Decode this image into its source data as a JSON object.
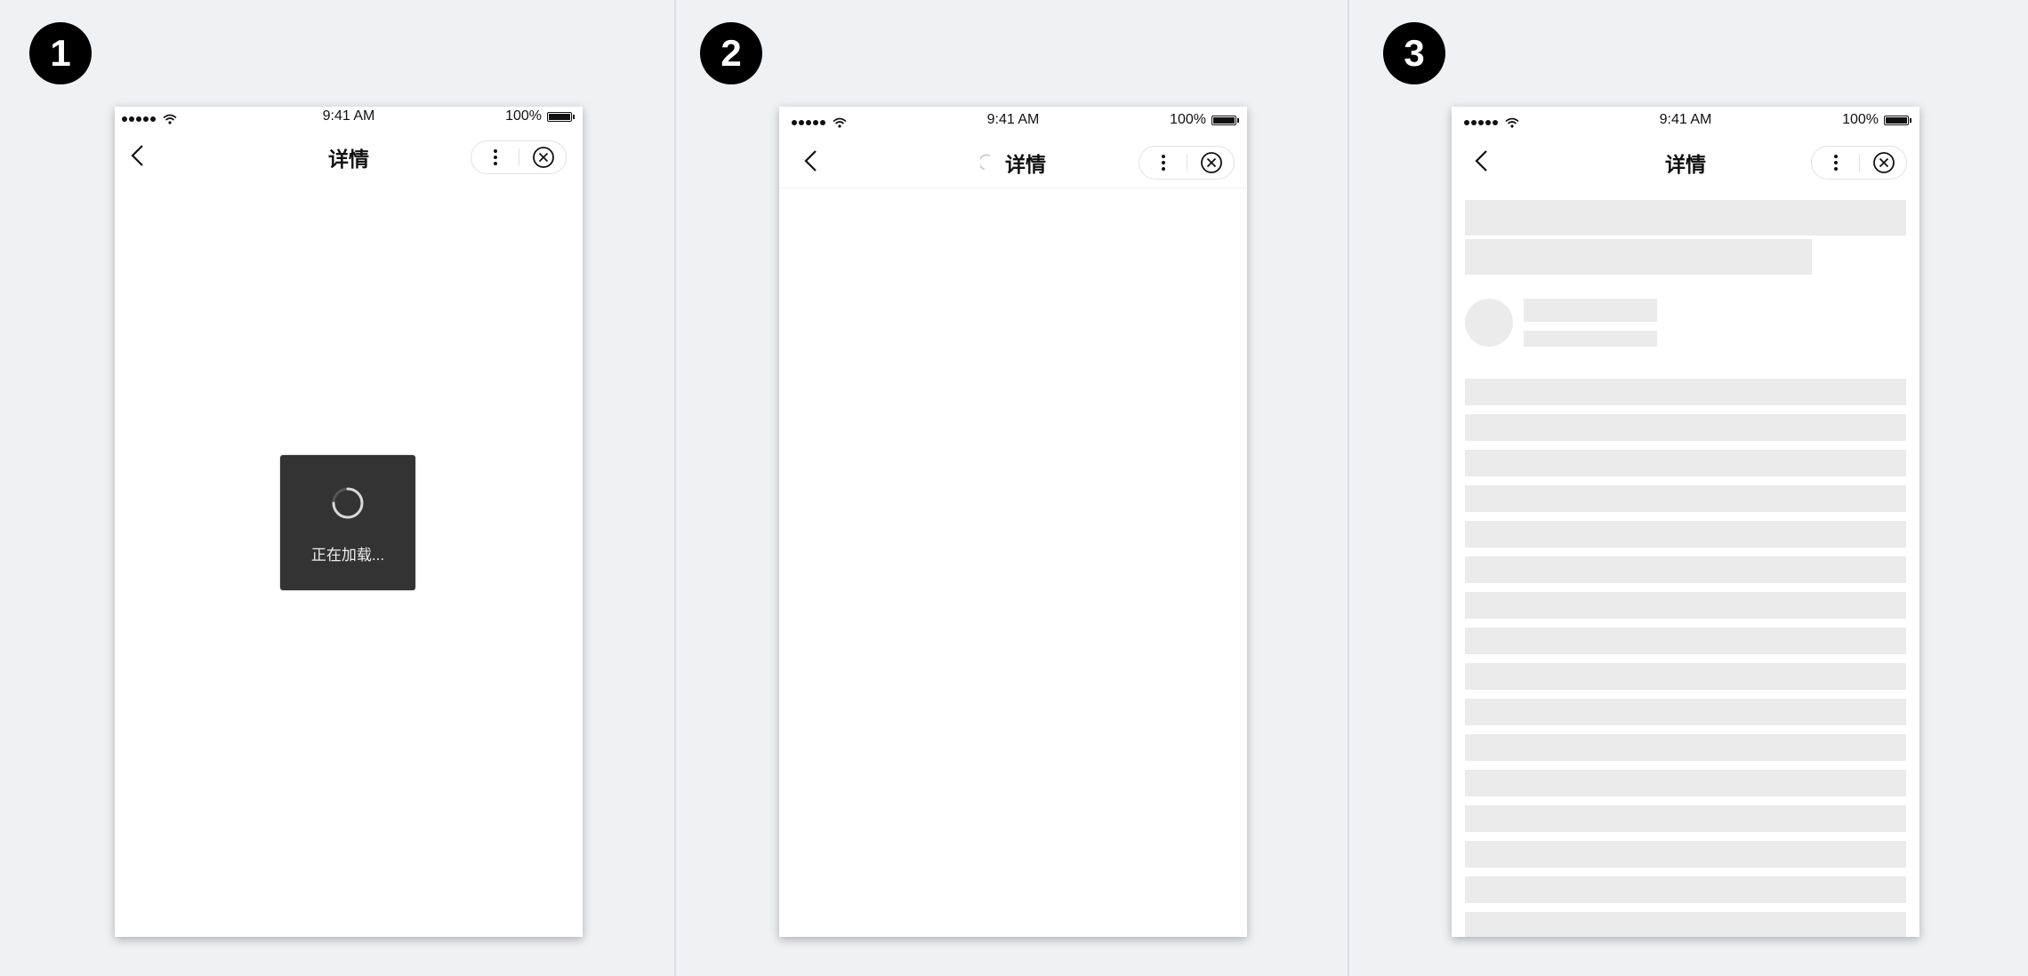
{
  "steps": [
    {
      "number": "1"
    },
    {
      "number": "2"
    },
    {
      "number": "3"
    }
  ],
  "status_bar": {
    "time": "9:41 AM",
    "battery": "100%"
  },
  "nav": {
    "title": "详情"
  },
  "toast": {
    "text": "正在加载..."
  },
  "colors": {
    "background": "#f0f1f3",
    "toast_bg": "#333333",
    "skeleton": "#ebebeb",
    "badge": "#000000"
  },
  "icons": [
    "signal-icon",
    "wifi-icon",
    "battery-icon",
    "back-chevron-icon",
    "more-icon",
    "close-circle-icon",
    "loading-spinner-icon"
  ]
}
